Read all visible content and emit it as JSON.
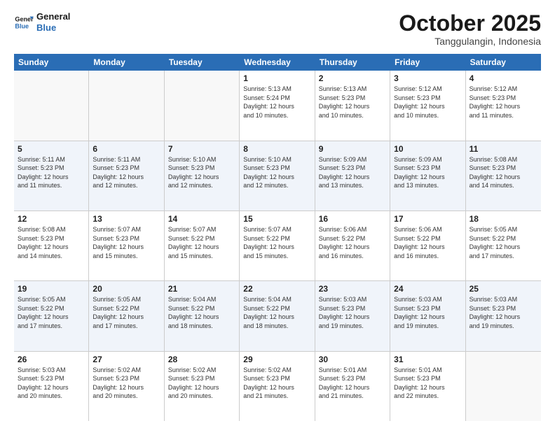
{
  "header": {
    "logo": {
      "line1": "General",
      "line2": "Blue"
    },
    "title": "October 2025",
    "subtitle": "Tanggulangin, Indonesia"
  },
  "weekdays": [
    "Sunday",
    "Monday",
    "Tuesday",
    "Wednesday",
    "Thursday",
    "Friday",
    "Saturday"
  ],
  "rows": [
    {
      "alt": false,
      "cells": [
        {
          "empty": true,
          "day": "",
          "info": ""
        },
        {
          "empty": true,
          "day": "",
          "info": ""
        },
        {
          "empty": true,
          "day": "",
          "info": ""
        },
        {
          "empty": false,
          "day": "1",
          "info": "Sunrise: 5:13 AM\nSunset: 5:24 PM\nDaylight: 12 hours\nand 10 minutes."
        },
        {
          "empty": false,
          "day": "2",
          "info": "Sunrise: 5:13 AM\nSunset: 5:23 PM\nDaylight: 12 hours\nand 10 minutes."
        },
        {
          "empty": false,
          "day": "3",
          "info": "Sunrise: 5:12 AM\nSunset: 5:23 PM\nDaylight: 12 hours\nand 10 minutes."
        },
        {
          "empty": false,
          "day": "4",
          "info": "Sunrise: 5:12 AM\nSunset: 5:23 PM\nDaylight: 12 hours\nand 11 minutes."
        }
      ]
    },
    {
      "alt": true,
      "cells": [
        {
          "empty": false,
          "day": "5",
          "info": "Sunrise: 5:11 AM\nSunset: 5:23 PM\nDaylight: 12 hours\nand 11 minutes."
        },
        {
          "empty": false,
          "day": "6",
          "info": "Sunrise: 5:11 AM\nSunset: 5:23 PM\nDaylight: 12 hours\nand 12 minutes."
        },
        {
          "empty": false,
          "day": "7",
          "info": "Sunrise: 5:10 AM\nSunset: 5:23 PM\nDaylight: 12 hours\nand 12 minutes."
        },
        {
          "empty": false,
          "day": "8",
          "info": "Sunrise: 5:10 AM\nSunset: 5:23 PM\nDaylight: 12 hours\nand 12 minutes."
        },
        {
          "empty": false,
          "day": "9",
          "info": "Sunrise: 5:09 AM\nSunset: 5:23 PM\nDaylight: 12 hours\nand 13 minutes."
        },
        {
          "empty": false,
          "day": "10",
          "info": "Sunrise: 5:09 AM\nSunset: 5:23 PM\nDaylight: 12 hours\nand 13 minutes."
        },
        {
          "empty": false,
          "day": "11",
          "info": "Sunrise: 5:08 AM\nSunset: 5:23 PM\nDaylight: 12 hours\nand 14 minutes."
        }
      ]
    },
    {
      "alt": false,
      "cells": [
        {
          "empty": false,
          "day": "12",
          "info": "Sunrise: 5:08 AM\nSunset: 5:23 PM\nDaylight: 12 hours\nand 14 minutes."
        },
        {
          "empty": false,
          "day": "13",
          "info": "Sunrise: 5:07 AM\nSunset: 5:23 PM\nDaylight: 12 hours\nand 15 minutes."
        },
        {
          "empty": false,
          "day": "14",
          "info": "Sunrise: 5:07 AM\nSunset: 5:22 PM\nDaylight: 12 hours\nand 15 minutes."
        },
        {
          "empty": false,
          "day": "15",
          "info": "Sunrise: 5:07 AM\nSunset: 5:22 PM\nDaylight: 12 hours\nand 15 minutes."
        },
        {
          "empty": false,
          "day": "16",
          "info": "Sunrise: 5:06 AM\nSunset: 5:22 PM\nDaylight: 12 hours\nand 16 minutes."
        },
        {
          "empty": false,
          "day": "17",
          "info": "Sunrise: 5:06 AM\nSunset: 5:22 PM\nDaylight: 12 hours\nand 16 minutes."
        },
        {
          "empty": false,
          "day": "18",
          "info": "Sunrise: 5:05 AM\nSunset: 5:22 PM\nDaylight: 12 hours\nand 17 minutes."
        }
      ]
    },
    {
      "alt": true,
      "cells": [
        {
          "empty": false,
          "day": "19",
          "info": "Sunrise: 5:05 AM\nSunset: 5:22 PM\nDaylight: 12 hours\nand 17 minutes."
        },
        {
          "empty": false,
          "day": "20",
          "info": "Sunrise: 5:05 AM\nSunset: 5:22 PM\nDaylight: 12 hours\nand 17 minutes."
        },
        {
          "empty": false,
          "day": "21",
          "info": "Sunrise: 5:04 AM\nSunset: 5:22 PM\nDaylight: 12 hours\nand 18 minutes."
        },
        {
          "empty": false,
          "day": "22",
          "info": "Sunrise: 5:04 AM\nSunset: 5:22 PM\nDaylight: 12 hours\nand 18 minutes."
        },
        {
          "empty": false,
          "day": "23",
          "info": "Sunrise: 5:03 AM\nSunset: 5:23 PM\nDaylight: 12 hours\nand 19 minutes."
        },
        {
          "empty": false,
          "day": "24",
          "info": "Sunrise: 5:03 AM\nSunset: 5:23 PM\nDaylight: 12 hours\nand 19 minutes."
        },
        {
          "empty": false,
          "day": "25",
          "info": "Sunrise: 5:03 AM\nSunset: 5:23 PM\nDaylight: 12 hours\nand 19 minutes."
        }
      ]
    },
    {
      "alt": false,
      "cells": [
        {
          "empty": false,
          "day": "26",
          "info": "Sunrise: 5:03 AM\nSunset: 5:23 PM\nDaylight: 12 hours\nand 20 minutes."
        },
        {
          "empty": false,
          "day": "27",
          "info": "Sunrise: 5:02 AM\nSunset: 5:23 PM\nDaylight: 12 hours\nand 20 minutes."
        },
        {
          "empty": false,
          "day": "28",
          "info": "Sunrise: 5:02 AM\nSunset: 5:23 PM\nDaylight: 12 hours\nand 20 minutes."
        },
        {
          "empty": false,
          "day": "29",
          "info": "Sunrise: 5:02 AM\nSunset: 5:23 PM\nDaylight: 12 hours\nand 21 minutes."
        },
        {
          "empty": false,
          "day": "30",
          "info": "Sunrise: 5:01 AM\nSunset: 5:23 PM\nDaylight: 12 hours\nand 21 minutes."
        },
        {
          "empty": false,
          "day": "31",
          "info": "Sunrise: 5:01 AM\nSunset: 5:23 PM\nDaylight: 12 hours\nand 22 minutes."
        },
        {
          "empty": true,
          "day": "",
          "info": ""
        }
      ]
    }
  ]
}
